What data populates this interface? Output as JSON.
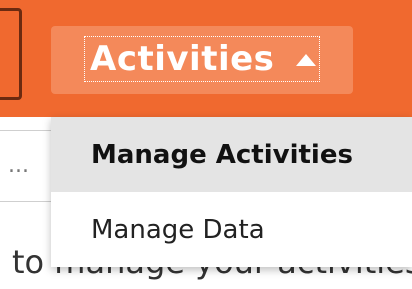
{
  "header": {
    "activities_label": "Activities",
    "caret_icon": "caret-up-icon",
    "bar_color": "#f0692f",
    "button_color": "#f4895a"
  },
  "dropdown": {
    "items": [
      {
        "label": "Manage Activities",
        "active": true
      },
      {
        "label": "Manage Data",
        "active": false
      }
    ]
  },
  "background": {
    "search_ellipsis": "...",
    "help_text": "to manage your activities."
  }
}
